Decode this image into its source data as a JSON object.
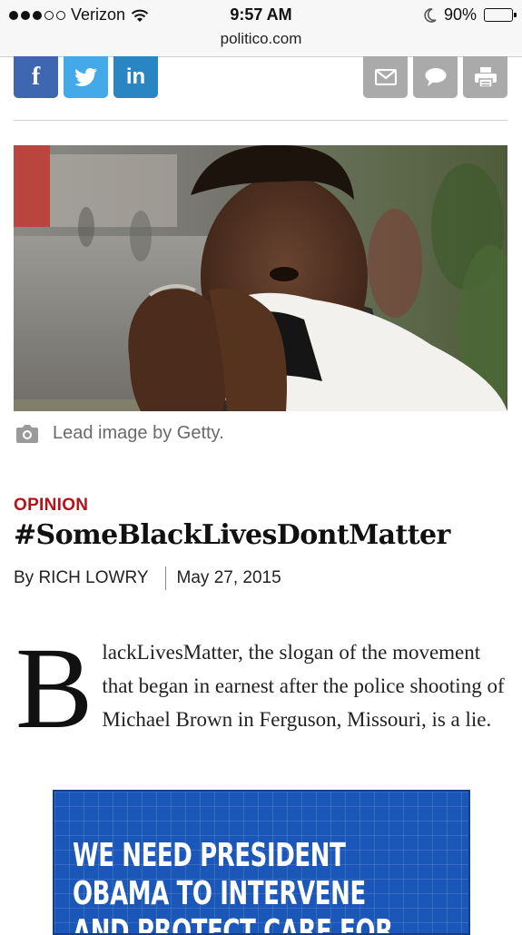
{
  "status_bar": {
    "carrier": "Verizon",
    "time": "9:57 AM",
    "battery": "90%",
    "battery_level": 0.9,
    "url": "politico.com"
  },
  "share_bar": {
    "facebook_label": "f",
    "twitter_icon": "twitter-bird-icon",
    "linkedin_label": "in",
    "email_icon": "envelope-icon",
    "comment_icon": "speech-bubble-icon",
    "print_icon": "printer-icon"
  },
  "lead_image": {
    "caption": "Lead image by Getty."
  },
  "article": {
    "kicker": "OPINION",
    "headline": "#SomeBlackLivesDontMatter",
    "byline": "By RICH LOWRY",
    "date": "May 27, 2015",
    "drop_cap": "B",
    "first_paragraph": "lackLivesMatter, the slogan of the movement that began in earnest after the police shooting of Michael Brown in Ferguson, Missouri, is a lie."
  },
  "ad": {
    "line1": "WE NEED PRESIDENT",
    "line2": "OBAMA TO INTERVENE",
    "line3": "AND PROTECT CARE FOR"
  },
  "colors": {
    "facebook": "#3f66b0",
    "twitter": "#44a9e8",
    "linkedin": "#2a86c3",
    "kicker_red": "#b5121b",
    "ad_blue": "#1b57b8"
  }
}
